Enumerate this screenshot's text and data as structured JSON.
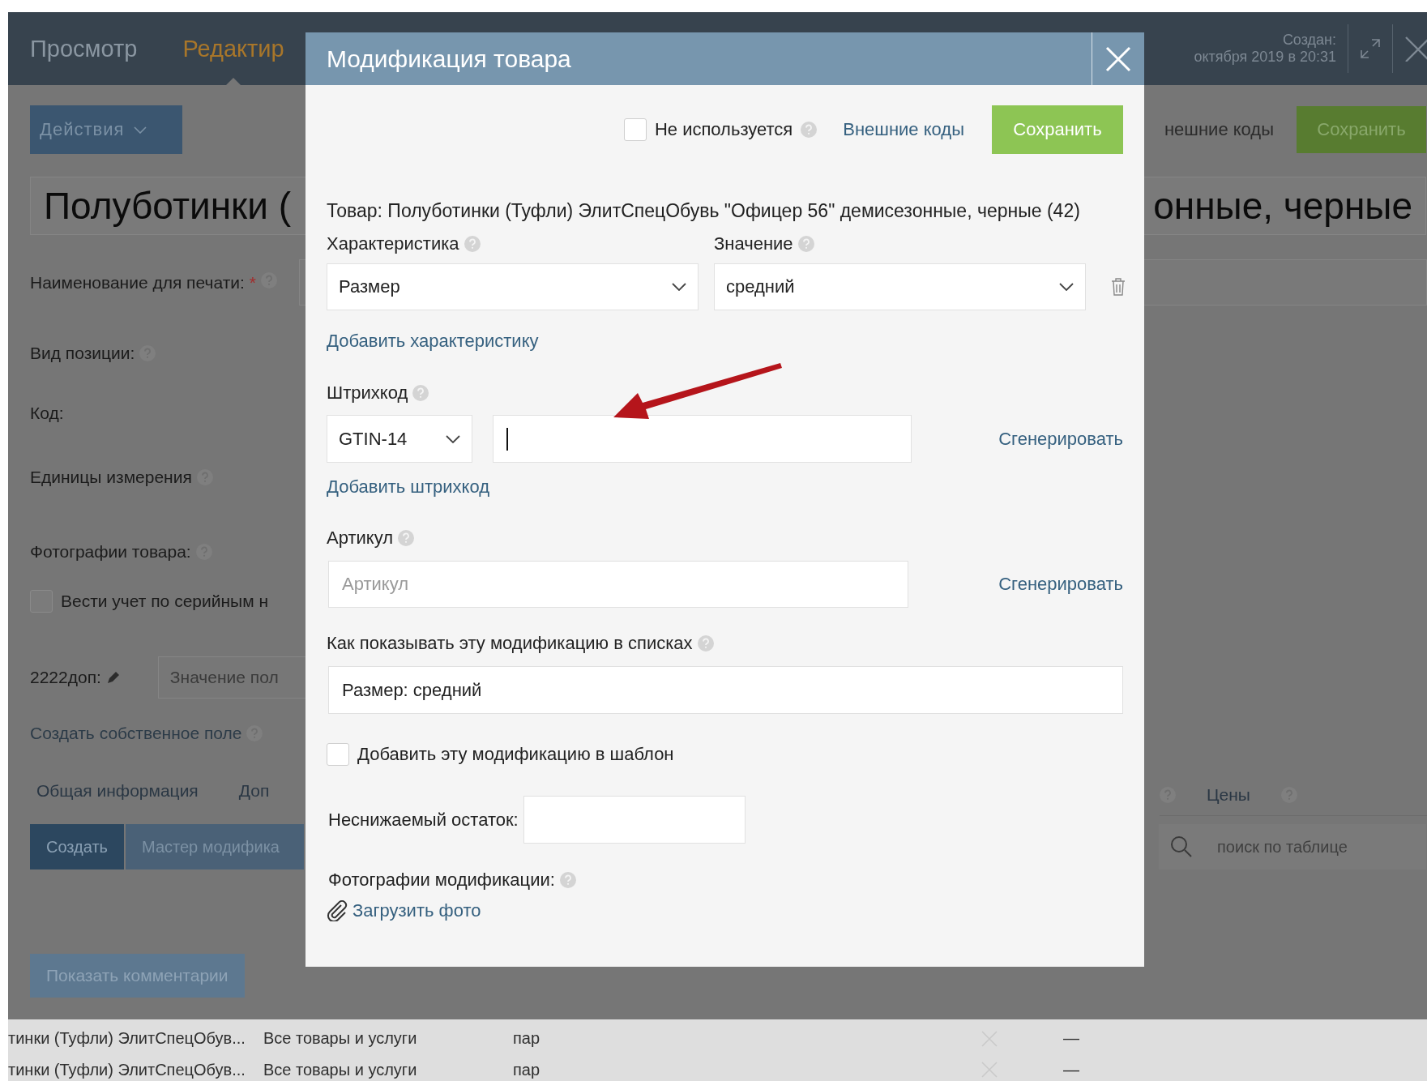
{
  "header": {
    "tabs": [
      {
        "label": "Просмотр",
        "selected": false
      },
      {
        "label": "Редактир",
        "selected": true
      }
    ],
    "created_label": "Создан:",
    "created_date": "октября 2019 в 20:31"
  },
  "page": {
    "actions_button": "Действия",
    "external_codes_link": "нешние коды",
    "save_button": "Сохранить",
    "title_left": "Полуботинки (",
    "title_right": "онные, черные",
    "print_name_label": "Наименование для печати:",
    "required_mark": "*",
    "position_type_label": "Вид позиции:",
    "code_label": "Код:",
    "units_label": "Единицы измерения",
    "photos_label": "Фотографии товара:",
    "serial_checkbox": {
      "label": "Вести учет по серийным н",
      "checked": false
    },
    "custom_field": {
      "label": "2222доп:",
      "placeholder": "Значение пол"
    },
    "create_field_link": "Создать собственное поле",
    "tabs": [
      {
        "label": "Общая информация"
      },
      {
        "label": "Доп"
      }
    ],
    "right_tab": "Цены",
    "create_button": "Создать",
    "wizard_button": "Мастер модифика",
    "search_placeholder": "поиск по таблице",
    "comments_button": "Показать комментарии"
  },
  "table": {
    "rows": [
      {
        "name": "тинки (Туфли) ЭлитСпецОбув...",
        "group": "Все товары и услуги",
        "unit": "пар",
        "dash": "—"
      },
      {
        "name": "тинки (Туфли) ЭлитСпецОбув...",
        "group": "Все товары и услуги",
        "unit": "пар",
        "dash": "—"
      }
    ]
  },
  "dialog": {
    "title": "Модификация товара",
    "unused_checkbox": {
      "label": "Не используется",
      "checked": false
    },
    "external_codes_link": "Внешние коды",
    "save_button": "Сохранить",
    "product_line": "Товар: Полуботинки (Туфли) ЭлитСпецОбувь \"Офицер 56\" демисезонные, черные (42)",
    "characteristic_label": "Характеристика",
    "value_label": "Значение",
    "characteristic": "Размер",
    "value": "средний",
    "add_characteristic_link": "Добавить характеристику",
    "barcode_label": "Штрихкод",
    "barcode_type": "GTIN-14",
    "generate_barcode_link": "Сгенерировать",
    "add_barcode_link": "Добавить штрихкод",
    "article_label": "Артикул",
    "article_placeholder": "Артикул",
    "generate_article_link": "Сгенерировать",
    "list_display_label": "Как показывать эту модификацию в списках",
    "list_display_value": "Размер: средний",
    "template_checkbox": {
      "label": "Добавить эту модификацию в шаблон",
      "checked": false
    },
    "min_stock_label": "Неснижаемый остаток:",
    "photos_label": "Фотографии модификации:",
    "upload_photo_link": "Загрузить фото"
  }
}
